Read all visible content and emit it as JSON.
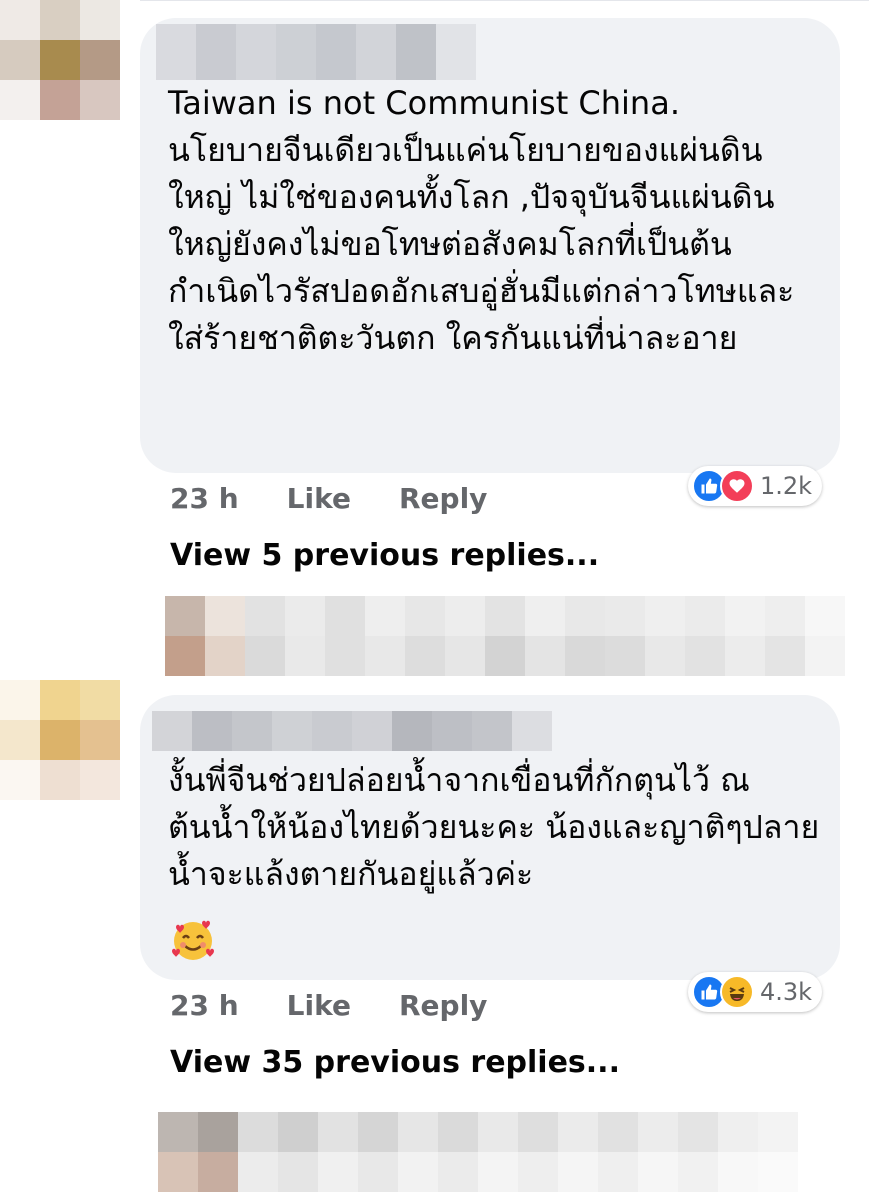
{
  "comments": [
    {
      "text": "Taiwan is not Communist China.\nนโยบายจีนเดียวเป็นแค่นโยบายของแผ่นดินใหญ่ ไม่ใช่ของคนทั้งโลก ,ปัจจุบันจีนแผ่นดินใหญ่ยังคงไม่ขอโทษต่อสังคมโลกที่เป็นต้นกำเนิดไวรัสปอดอักเสบอู่ฮั่นมีแต่กล่าวโทษและใส่ร้ายชาติตะวันตก ใครกันแน่ที่น่าละอาย",
      "time": "23 h",
      "like_label": "Like",
      "reply_label": "Reply",
      "reaction_count": "1.2k",
      "reactions": [
        "like-icon",
        "love-icon"
      ],
      "view_replies": "View 5 previous replies..."
    },
    {
      "text": "งั้นพี่จีนช่วยปล่อยน้ำจากเขื่อนที่กักตุนไว้ ณ ต้นน้ำให้น้องไทยด้วยนะคะ น้องและญาติๆปลายน้ำจะแล้งตายกันอยู่แล้วค่ะ",
      "emoji": "smiling-face-with-hearts-emoji",
      "time": "23 h",
      "like_label": "Like",
      "reply_label": "Reply",
      "reaction_count": "4.3k",
      "reactions": [
        "like-icon",
        "haha-icon"
      ],
      "view_replies": "View 35 previous replies..."
    }
  ],
  "colors": {
    "bubble": "#f0f2f5",
    "meta_text": "#65676b",
    "like_blue": "#1877f2",
    "love_red": "#f33e58",
    "haha_yellow": "#f7b928"
  }
}
